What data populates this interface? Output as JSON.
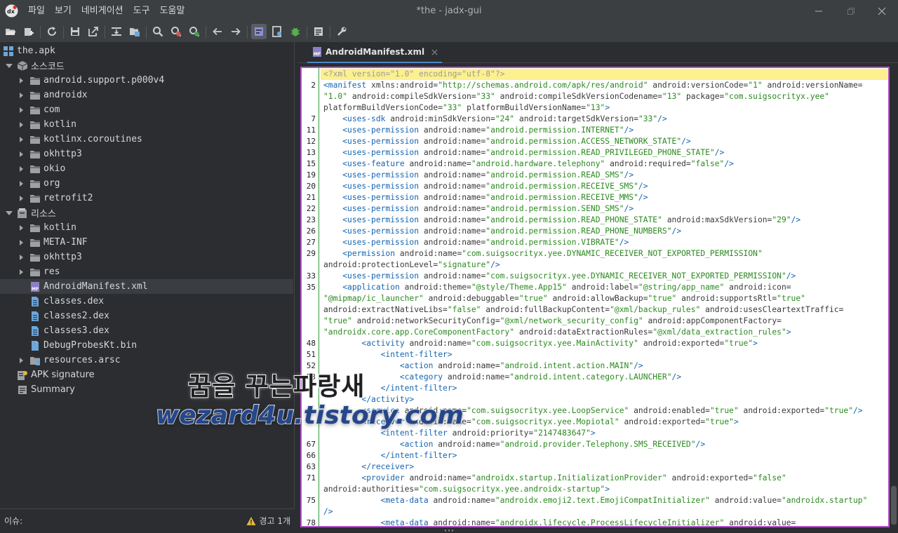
{
  "window": {
    "title": "*the - jadx-gui",
    "menu": [
      "파일",
      "보기",
      "네비게이션",
      "도구",
      "도움말"
    ]
  },
  "toolbar": {
    "icons": [
      "open-file-icon",
      "add-files-icon",
      "reload-icon",
      "save-all-icon",
      "export-gradle-icon",
      "sync-tree-icon",
      "flatten-packages-icon",
      "search-text-icon",
      "search-class-icon",
      "search-usage-icon",
      "back-icon",
      "forward-icon",
      "quark-icon",
      "log-viewer-icon",
      "debugger-icon",
      "preferences-icon"
    ]
  },
  "tree": {
    "root": "the.apk",
    "source_label": "소스코드",
    "source_packages": [
      "android.support.p000v4",
      "androidx",
      "com",
      "kotlin",
      "kotlinx.coroutines",
      "okhttp3",
      "okio",
      "org",
      "retrofit2"
    ],
    "resources_label": "리소스",
    "resource_folders": [
      "kotlin",
      "META-INF",
      "okhttp3",
      "res"
    ],
    "resource_files": [
      "AndroidManifest.xml",
      "classes.dex",
      "classes2.dex",
      "classes3.dex",
      "DebugProbesKt.bin"
    ],
    "resources_arsc": "resources.arsc",
    "apk_signature": "APK signature",
    "summary": "Summary",
    "selected": "AndroidManifest.xml"
  },
  "status": {
    "issues_label": "이슈:",
    "warning_text": "경고 1개"
  },
  "editor": {
    "tab_label": "AndroidManifest.xml",
    "lines": [
      {
        "n": "",
        "hl": true,
        "parts": [
          [
            "pi",
            "<?xml version=\"1.0\" encoding=\"utf-8\"?>"
          ]
        ]
      },
      {
        "n": "2",
        "parts": [
          [
            "t",
            "<manifest "
          ],
          [
            "a",
            "xmlns:android="
          ],
          [
            "v",
            "\"http://schemas.android.com/apk/res/android\""
          ],
          [
            "a",
            " android:versionCode="
          ],
          [
            "v",
            "\"1\""
          ],
          [
            "a",
            " android:versionName="
          ]
        ]
      },
      {
        "n": "",
        "parts": [
          [
            "v",
            "\"1.0\""
          ],
          [
            "a",
            " android:compileSdkVersion="
          ],
          [
            "v",
            "\"33\""
          ],
          [
            "a",
            " android:compileSdkVersionCodename="
          ],
          [
            "v",
            "\"13\""
          ],
          [
            "a",
            " package="
          ],
          [
            "v",
            "\"com.suigsocrityx.yee\""
          ]
        ]
      },
      {
        "n": "",
        "parts": [
          [
            "a",
            "platformBuildVersionCode="
          ],
          [
            "v",
            "\"33\""
          ],
          [
            "a",
            " platformBuildVersionName="
          ],
          [
            "v",
            "\"13\""
          ],
          [
            "t",
            ">"
          ]
        ]
      },
      {
        "n": "7",
        "parts": [
          [
            "a",
            "    "
          ],
          [
            "t",
            "<uses-sdk "
          ],
          [
            "a",
            "android:minSdkVersion="
          ],
          [
            "v",
            "\"24\""
          ],
          [
            "a",
            " android:targetSdkVersion="
          ],
          [
            "v",
            "\"33\""
          ],
          [
            "t",
            "/>"
          ]
        ]
      },
      {
        "n": "11",
        "parts": [
          [
            "a",
            "    "
          ],
          [
            "t",
            "<uses-permission "
          ],
          [
            "a",
            "android:name="
          ],
          [
            "v",
            "\"android.permission.INTERNET\""
          ],
          [
            "t",
            "/>"
          ]
        ]
      },
      {
        "n": "12",
        "parts": [
          [
            "a",
            "    "
          ],
          [
            "t",
            "<uses-permission "
          ],
          [
            "a",
            "android:name="
          ],
          [
            "v",
            "\"android.permission.ACCESS_NETWORK_STATE\""
          ],
          [
            "t",
            "/>"
          ]
        ]
      },
      {
        "n": "13",
        "parts": [
          [
            "a",
            "    "
          ],
          [
            "t",
            "<uses-permission "
          ],
          [
            "a",
            "android:name="
          ],
          [
            "v",
            "\"android.permission.READ_PRIVILEGED_PHONE_STATE\""
          ],
          [
            "t",
            "/>"
          ]
        ]
      },
      {
        "n": "15",
        "parts": [
          [
            "a",
            "    "
          ],
          [
            "t",
            "<uses-feature "
          ],
          [
            "a",
            "android:name="
          ],
          [
            "v",
            "\"android.hardware.telephony\""
          ],
          [
            "a",
            " android:required="
          ],
          [
            "v",
            "\"false\""
          ],
          [
            "t",
            "/>"
          ]
        ]
      },
      {
        "n": "19",
        "parts": [
          [
            "a",
            "    "
          ],
          [
            "t",
            "<uses-permission "
          ],
          [
            "a",
            "android:name="
          ],
          [
            "v",
            "\"android.permission.READ_SMS\""
          ],
          [
            "t",
            "/>"
          ]
        ]
      },
      {
        "n": "20",
        "parts": [
          [
            "a",
            "    "
          ],
          [
            "t",
            "<uses-permission "
          ],
          [
            "a",
            "android:name="
          ],
          [
            "v",
            "\"android.permission.RECEIVE_SMS\""
          ],
          [
            "t",
            "/>"
          ]
        ]
      },
      {
        "n": "21",
        "parts": [
          [
            "a",
            "    "
          ],
          [
            "t",
            "<uses-permission "
          ],
          [
            "a",
            "android:name="
          ],
          [
            "v",
            "\"android.permission.RECEIVE_MMS\""
          ],
          [
            "t",
            "/>"
          ]
        ]
      },
      {
        "n": "22",
        "parts": [
          [
            "a",
            "    "
          ],
          [
            "t",
            "<uses-permission "
          ],
          [
            "a",
            "android:name="
          ],
          [
            "v",
            "\"android.permission.SEND_SMS\""
          ],
          [
            "t",
            "/>"
          ]
        ]
      },
      {
        "n": "23",
        "parts": [
          [
            "a",
            "    "
          ],
          [
            "t",
            "<uses-permission "
          ],
          [
            "a",
            "android:name="
          ],
          [
            "v",
            "\"android.permission.READ_PHONE_STATE\""
          ],
          [
            "a",
            " android:maxSdkVersion="
          ],
          [
            "v",
            "\"29\""
          ],
          [
            "t",
            "/>"
          ]
        ]
      },
      {
        "n": "26",
        "parts": [
          [
            "a",
            "    "
          ],
          [
            "t",
            "<uses-permission "
          ],
          [
            "a",
            "android:name="
          ],
          [
            "v",
            "\"android.permission.READ_PHONE_NUMBERS\""
          ],
          [
            "t",
            "/>"
          ]
        ]
      },
      {
        "n": "27",
        "parts": [
          [
            "a",
            "    "
          ],
          [
            "t",
            "<uses-permission "
          ],
          [
            "a",
            "android:name="
          ],
          [
            "v",
            "\"android.permission.VIBRATE\""
          ],
          [
            "t",
            "/>"
          ]
        ]
      },
      {
        "n": "29",
        "parts": [
          [
            "a",
            "    "
          ],
          [
            "t",
            "<permission "
          ],
          [
            "a",
            "android:name="
          ],
          [
            "v",
            "\"com.suigsocrityx.yee.DYNAMIC_RECEIVER_NOT_EXPORTED_PERMISSION\""
          ]
        ]
      },
      {
        "n": "",
        "parts": [
          [
            "a",
            "android:protectionLevel="
          ],
          [
            "v",
            "\"signature\""
          ],
          [
            "t",
            "/>"
          ]
        ]
      },
      {
        "n": "33",
        "parts": [
          [
            "a",
            "    "
          ],
          [
            "t",
            "<uses-permission "
          ],
          [
            "a",
            "android:name="
          ],
          [
            "v",
            "\"com.suigsocrityx.yee.DYNAMIC_RECEIVER_NOT_EXPORTED_PERMISSION\""
          ],
          [
            "t",
            "/>"
          ]
        ]
      },
      {
        "n": "35",
        "parts": [
          [
            "a",
            "    "
          ],
          [
            "t",
            "<application "
          ],
          [
            "a",
            "android:theme="
          ],
          [
            "v",
            "\"@style/Theme.App15\""
          ],
          [
            "a",
            " android:label="
          ],
          [
            "v",
            "\"@string/app_name\""
          ],
          [
            "a",
            " android:icon="
          ]
        ]
      },
      {
        "n": "",
        "parts": [
          [
            "v",
            "\"@mipmap/ic_launcher\""
          ],
          [
            "a",
            " android:debuggable="
          ],
          [
            "v",
            "\"true\""
          ],
          [
            "a",
            " android:allowBackup="
          ],
          [
            "v",
            "\"true\""
          ],
          [
            "a",
            " android:supportsRtl="
          ],
          [
            "v",
            "\"true\""
          ]
        ]
      },
      {
        "n": "",
        "parts": [
          [
            "a",
            "android:extractNativeLibs="
          ],
          [
            "v",
            "\"false\""
          ],
          [
            "a",
            " android:fullBackupContent="
          ],
          [
            "v",
            "\"@xml/backup_rules\""
          ],
          [
            "a",
            " android:usesCleartextTraffic="
          ]
        ]
      },
      {
        "n": "",
        "parts": [
          [
            "v",
            "\"true\""
          ],
          [
            "a",
            " android:networkSecurityConfig="
          ],
          [
            "v",
            "\"@xml/network_security_config\""
          ],
          [
            "a",
            " android:appComponentFactory="
          ]
        ]
      },
      {
        "n": "",
        "parts": [
          [
            "v",
            "\"androidx.core.app.CoreComponentFactory\""
          ],
          [
            "a",
            " android:dataExtractionRules="
          ],
          [
            "v",
            "\"@xml/data_extraction_rules\""
          ],
          [
            "t",
            ">"
          ]
        ]
      },
      {
        "n": "48",
        "parts": [
          [
            "a",
            "        "
          ],
          [
            "t",
            "<activity "
          ],
          [
            "a",
            "android:name="
          ],
          [
            "v",
            "\"com.suigsocrityx.yee.MainActivity\""
          ],
          [
            "a",
            " android:exported="
          ],
          [
            "v",
            "\"true\""
          ],
          [
            "t",
            ">"
          ]
        ]
      },
      {
        "n": "51",
        "parts": [
          [
            "a",
            "            "
          ],
          [
            "t",
            "<intent-filter>"
          ]
        ]
      },
      {
        "n": "52",
        "parts": [
          [
            "a",
            "                "
          ],
          [
            "t",
            "<action "
          ],
          [
            "a",
            "android:name="
          ],
          [
            "v",
            "\"android.intent.action.MAIN\""
          ],
          [
            "t",
            "/>"
          ]
        ]
      },
      {
        "n": "53",
        "parts": [
          [
            "a",
            "                "
          ],
          [
            "t",
            "<category "
          ],
          [
            "a",
            "android:name="
          ],
          [
            "v",
            "\"android.intent.category.LAUNCHER\""
          ],
          [
            "t",
            "/>"
          ]
        ]
      },
      {
        "n": "",
        "parts": [
          [
            "a",
            "            "
          ],
          [
            "t",
            "</intent-filter>"
          ]
        ]
      },
      {
        "n": "",
        "parts": [
          [
            "a",
            "        "
          ],
          [
            "t",
            "</activity>"
          ]
        ]
      },
      {
        "n": "",
        "parts": [
          [
            "a",
            "        "
          ],
          [
            "t",
            "<service "
          ],
          [
            "a",
            "android:name="
          ],
          [
            "v",
            "\"com.suigsocrityx.yee.LoopService\""
          ],
          [
            "a",
            " android:enabled="
          ],
          [
            "v",
            "\"true\""
          ],
          [
            "a",
            " android:exported="
          ],
          [
            "v",
            "\"true\""
          ],
          [
            "t",
            "/>"
          ]
        ]
      },
      {
        "n": "",
        "parts": [
          [
            "a",
            "        "
          ],
          [
            "t",
            "<receiver "
          ],
          [
            "a",
            "android:name="
          ],
          [
            "v",
            "\"com.suigsocrityx.yee.Mopiotal\""
          ],
          [
            "a",
            " android:exported="
          ],
          [
            "v",
            "\"true\""
          ],
          [
            "t",
            ">"
          ]
        ]
      },
      {
        "n": "",
        "parts": [
          [
            "a",
            "            "
          ],
          [
            "t",
            "<intent-filter "
          ],
          [
            "a",
            "android:priority="
          ],
          [
            "v",
            "\"2147483647\""
          ],
          [
            "t",
            ">"
          ]
        ]
      },
      {
        "n": "67",
        "parts": [
          [
            "a",
            "                "
          ],
          [
            "t",
            "<action "
          ],
          [
            "a",
            "android:name="
          ],
          [
            "v",
            "\"android.provider.Telephony.SMS_RECEIVED\""
          ],
          [
            "t",
            "/>"
          ]
        ]
      },
      {
        "n": "66",
        "parts": [
          [
            "a",
            "            "
          ],
          [
            "t",
            "</intent-filter>"
          ]
        ]
      },
      {
        "n": "63",
        "parts": [
          [
            "a",
            "        "
          ],
          [
            "t",
            "</receiver>"
          ]
        ]
      },
      {
        "n": "71",
        "parts": [
          [
            "a",
            "        "
          ],
          [
            "t",
            "<provider "
          ],
          [
            "a",
            "android:name="
          ],
          [
            "v",
            "\"androidx.startup.InitializationProvider\""
          ],
          [
            "a",
            " android:exported="
          ],
          [
            "v",
            "\"false\""
          ]
        ]
      },
      {
        "n": "",
        "parts": [
          [
            "a",
            "android:authorities="
          ],
          [
            "v",
            "\"com.suigsocrityx.yee.androidx-startup\""
          ],
          [
            "t",
            ">"
          ]
        ]
      },
      {
        "n": "75",
        "parts": [
          [
            "a",
            "            "
          ],
          [
            "t",
            "<meta-data "
          ],
          [
            "a",
            "android:name="
          ],
          [
            "v",
            "\"androidx.emoji2.text.EmojiCompatInitializer\""
          ],
          [
            "a",
            " android:value="
          ],
          [
            "v",
            "\"androidx.startup\""
          ]
        ]
      },
      {
        "n": "",
        "parts": [
          [
            "t",
            "/>"
          ]
        ]
      },
      {
        "n": "78",
        "parts": [
          [
            "a",
            "            "
          ],
          [
            "t",
            "<meta-data "
          ],
          [
            "a",
            "android:name="
          ],
          [
            "v",
            "\"androidx.lifecycle.ProcessLifecycleInitializer\""
          ],
          [
            "a",
            " android:value="
          ]
        ]
      }
    ]
  },
  "watermark": {
    "line1": "꿈을 꾸는파랑새",
    "line2": "wezard4u.tistory.com"
  }
}
